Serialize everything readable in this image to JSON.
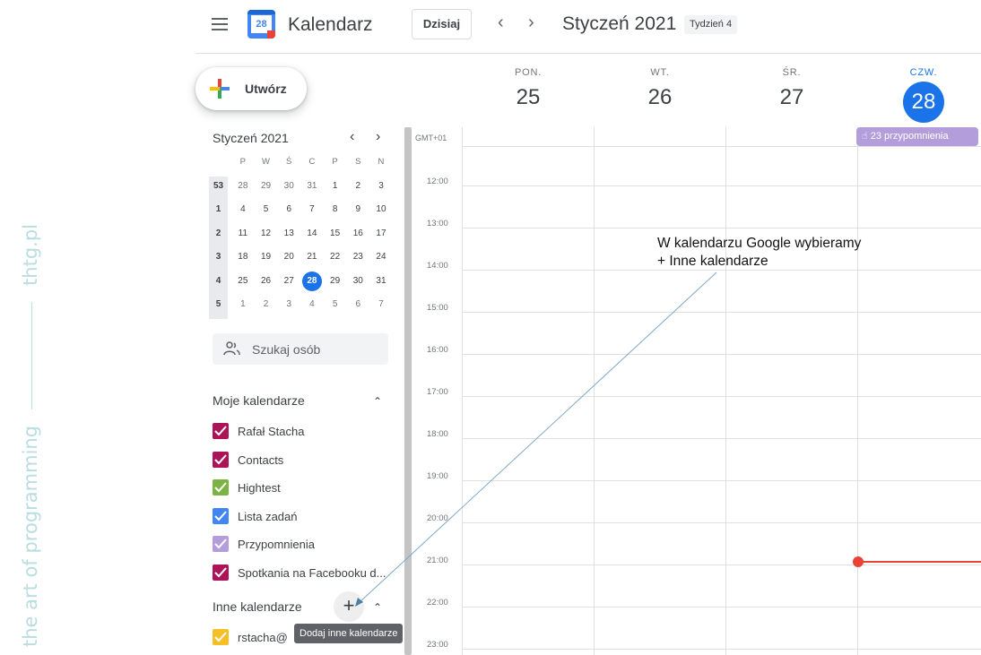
{
  "watermark": {
    "left_text": "the art of programming",
    "right_text": "thtg.pl"
  },
  "header": {
    "app_title": "Kalendarz",
    "logo_day": "28",
    "today_button": "Dzisiaj",
    "prev_icon": "chevron-left-icon",
    "next_icon": "chevron-right-icon",
    "month_title": "Styczeń 2021",
    "week_badge": "Tydzień 4"
  },
  "create_button": {
    "label": "Utwórz"
  },
  "mini_calendar": {
    "title": "Styczeń 2021",
    "weekday_headers": [
      "P",
      "W",
      "Ś",
      "C",
      "P",
      "S",
      "N"
    ],
    "weeks": [
      {
        "week": "53",
        "days": [
          "28",
          "29",
          "30",
          "31",
          "1",
          "2",
          "3"
        ]
      },
      {
        "week": "1",
        "days": [
          "4",
          "5",
          "6",
          "7",
          "8",
          "9",
          "10"
        ]
      },
      {
        "week": "2",
        "days": [
          "11",
          "12",
          "13",
          "14",
          "15",
          "16",
          "17"
        ]
      },
      {
        "week": "3",
        "days": [
          "18",
          "19",
          "20",
          "21",
          "22",
          "23",
          "24"
        ]
      },
      {
        "week": "4",
        "days": [
          "25",
          "26",
          "27",
          "28",
          "29",
          "30",
          "31"
        ]
      },
      {
        "week": "5",
        "days": [
          "1",
          "2",
          "3",
          "4",
          "5",
          "6",
          "7"
        ]
      }
    ],
    "selected_day": "28"
  },
  "search_people": {
    "placeholder": "Szukaj osób"
  },
  "my_calendars": {
    "title": "Moje kalendarze",
    "items": [
      {
        "label": "Rafał Stacha",
        "color": "#ad1457"
      },
      {
        "label": "Contacts",
        "color": "#ad1457"
      },
      {
        "label": "Hightest",
        "color": "#7cb342"
      },
      {
        "label": "Lista zadań",
        "color": "#4285f4"
      },
      {
        "label": "Przypomnienia",
        "color": "#b39ddb"
      },
      {
        "label": "Spotkania na Facebooku d...",
        "color": "#ad1457"
      }
    ]
  },
  "other_calendars": {
    "title": "Inne kalendarze",
    "add_tooltip": "Dodaj inne kalendarze",
    "items": [
      {
        "label": "rstacha@",
        "color": "#f6bf26"
      }
    ]
  },
  "week_view": {
    "timezone": "GMT+01",
    "days": [
      {
        "name": "PON.",
        "num": "25"
      },
      {
        "name": "WT.",
        "num": "26"
      },
      {
        "name": "ŚR.",
        "num": "27"
      },
      {
        "name": "CZW.",
        "num": "28"
      }
    ],
    "hours": [
      "12:00",
      "13:00",
      "14:00",
      "15:00",
      "16:00",
      "17:00",
      "18:00",
      "19:00",
      "20:00",
      "21:00",
      "22:00",
      "23:00"
    ],
    "reminder_chip": "23 przypomnienia",
    "current_time_color": "#ea4335"
  },
  "annotation": {
    "line1": "W kalendarzu Google wybieramy",
    "line2": "+ Inne kalendarze"
  },
  "colors": {
    "accent": "#1a73e8"
  }
}
